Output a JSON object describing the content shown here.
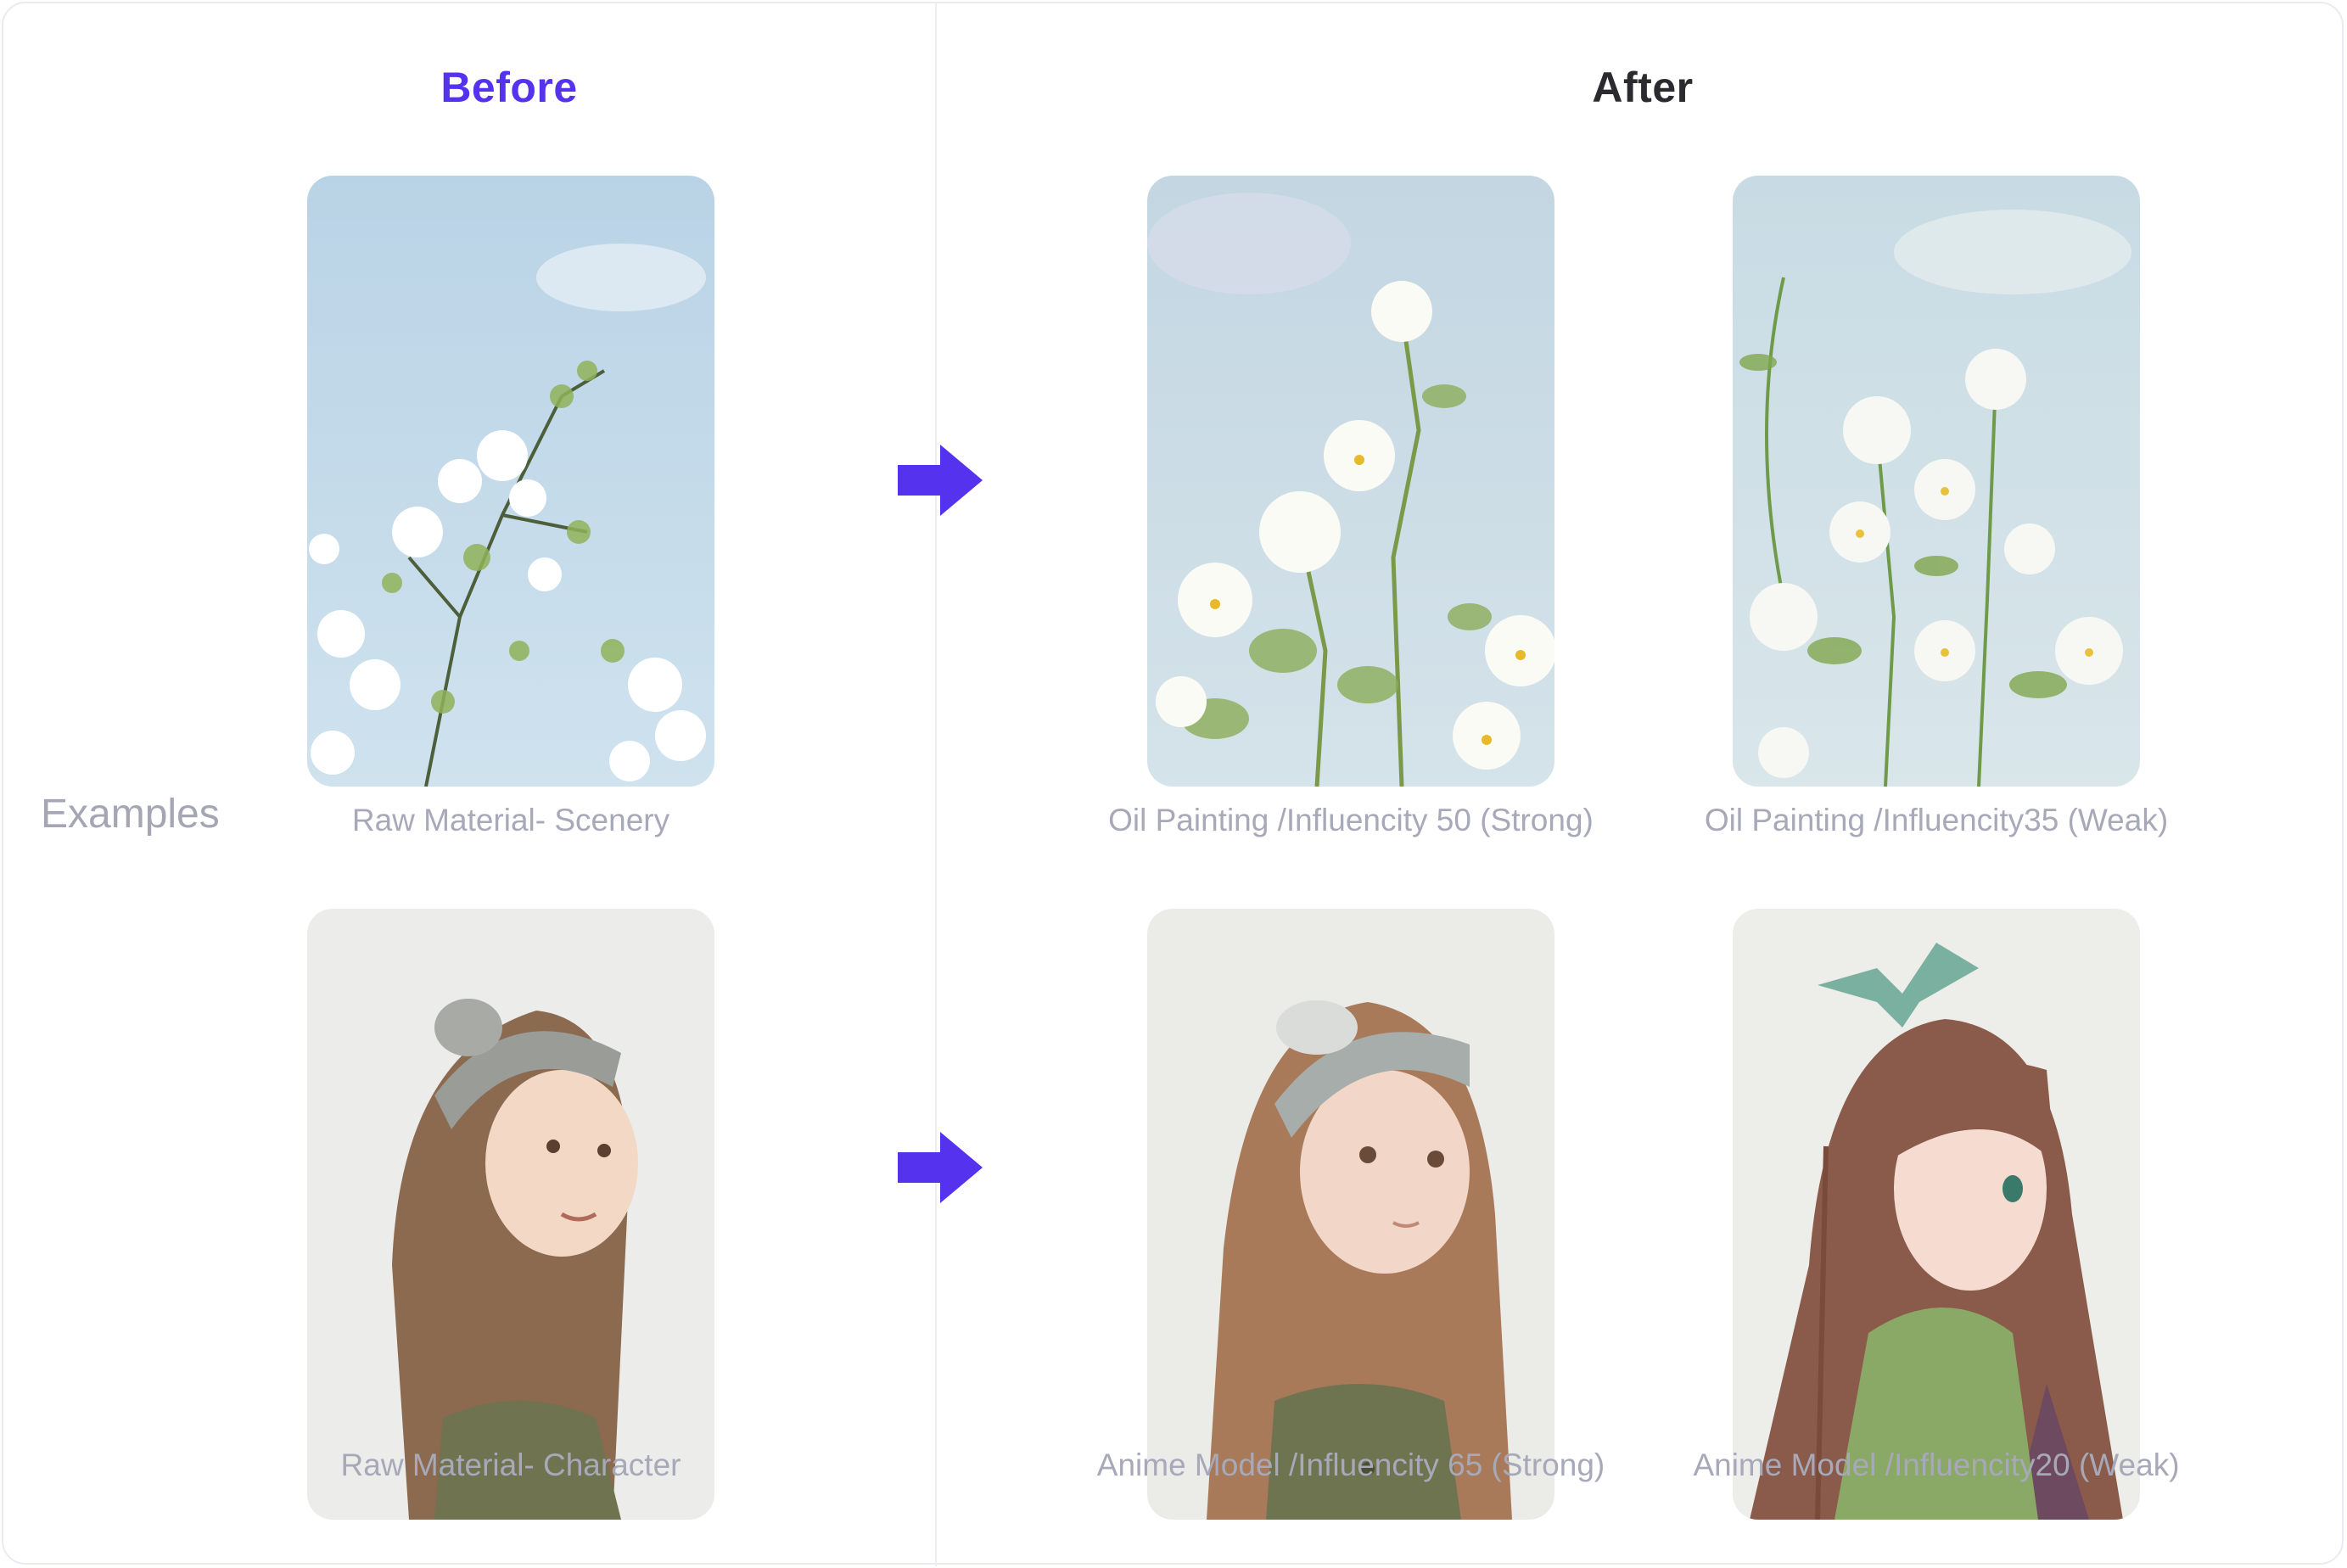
{
  "headings": {
    "before": "Before",
    "after": "After"
  },
  "side_label": "Examples",
  "rows": [
    {
      "before": {
        "caption": "Raw Material- Scenery",
        "image": "photo of white blossoms against blue sky"
      },
      "after": [
        {
          "caption": "Oil Painting /Influencity 50 (Strong)",
          "image": "oil painting of white flowers, strong"
        },
        {
          "caption": "Oil Painting /Influencity35 (Weak)",
          "image": "oil painting of white flowers, weak"
        }
      ]
    },
    {
      "before": {
        "caption": "Raw Material- Character",
        "image": "photo of girl with headband"
      },
      "after": [
        {
          "caption": "Anime Model /Influencity 65 (Strong)",
          "image": "anime-style girl with headband, strong"
        },
        {
          "caption": "Anime Model /Influencity20 (Weak)",
          "image": "anime girl with green bow, weak"
        }
      ]
    }
  ],
  "icons": {
    "transform_arrow": "arrow-right-icon"
  },
  "colors": {
    "accent": "#5533ee",
    "heading_after": "#2b2b2f",
    "caption": "#a7a9b8",
    "side_label": "#a4a6b4"
  }
}
